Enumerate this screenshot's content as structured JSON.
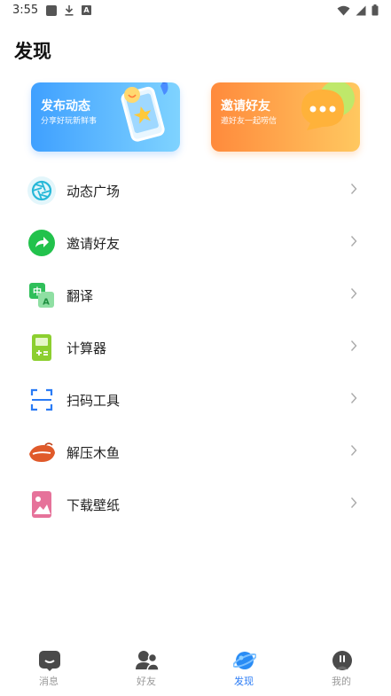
{
  "status_bar": {
    "time": "3:55",
    "a_badge": "A"
  },
  "page_title": "发现",
  "cards": {
    "post": {
      "title": "发布动态",
      "subtitle": "分享好玩新鲜事"
    },
    "invite": {
      "title": "邀请好友",
      "subtitle": "邀好友一起唠信"
    }
  },
  "menu": [
    {
      "label": "动态广场",
      "icon": "aperture-icon"
    },
    {
      "label": "邀请好友",
      "icon": "share-arrow-icon"
    },
    {
      "label": "翻译",
      "icon": "translate-icon",
      "icon_text_1": "中",
      "icon_text_2": "A"
    },
    {
      "label": "计算器",
      "icon": "calculator-icon"
    },
    {
      "label": "扫码工具",
      "icon": "scan-icon"
    },
    {
      "label": "解压木鱼",
      "icon": "wooden-fish-icon"
    },
    {
      "label": "下载壁纸",
      "icon": "wallpaper-icon"
    }
  ],
  "tabs": [
    {
      "label": "消息",
      "icon": "message-icon"
    },
    {
      "label": "好友",
      "icon": "friends-icon"
    },
    {
      "label": "发现",
      "icon": "planet-icon",
      "active": true
    },
    {
      "label": "我的",
      "icon": "profile-icon"
    }
  ],
  "colors": {
    "accent": "#2a7bf5",
    "post_card": "#3fa0ff",
    "invite_card": "#ff8a3c"
  }
}
